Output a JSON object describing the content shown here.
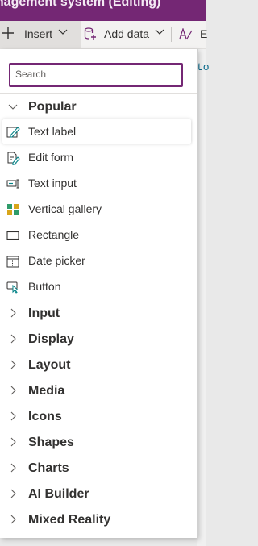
{
  "titlebar": {
    "title": "anagement system (Editing)"
  },
  "toolbar": {
    "insert_label": "Insert",
    "add_data_label": "Add data",
    "theme_label": "E"
  },
  "canvas": {
    "fragment": "to"
  },
  "flyout": {
    "search_placeholder": "Search",
    "popular": {
      "label": "Popular",
      "items": [
        {
          "label": "Text label",
          "icon": "text-label-icon"
        },
        {
          "label": "Edit form",
          "icon": "edit-form-icon"
        },
        {
          "label": "Text input",
          "icon": "text-input-icon"
        },
        {
          "label": "Vertical gallery",
          "icon": "vertical-gallery-icon"
        },
        {
          "label": "Rectangle",
          "icon": "rectangle-icon"
        },
        {
          "label": "Date picker",
          "icon": "date-picker-icon"
        },
        {
          "label": "Button",
          "icon": "button-icon"
        }
      ]
    },
    "categories": [
      {
        "label": "Input"
      },
      {
        "label": "Display"
      },
      {
        "label": "Layout"
      },
      {
        "label": "Media"
      },
      {
        "label": "Icons"
      },
      {
        "label": "Shapes"
      },
      {
        "label": "Charts"
      },
      {
        "label": "AI Builder"
      },
      {
        "label": "Mixed Reality"
      }
    ]
  },
  "colors": {
    "accent": "#742774",
    "gallery_green": "#2e9c6a",
    "gallery_gold": "#d8a51a",
    "edit_teal": "#038387"
  }
}
